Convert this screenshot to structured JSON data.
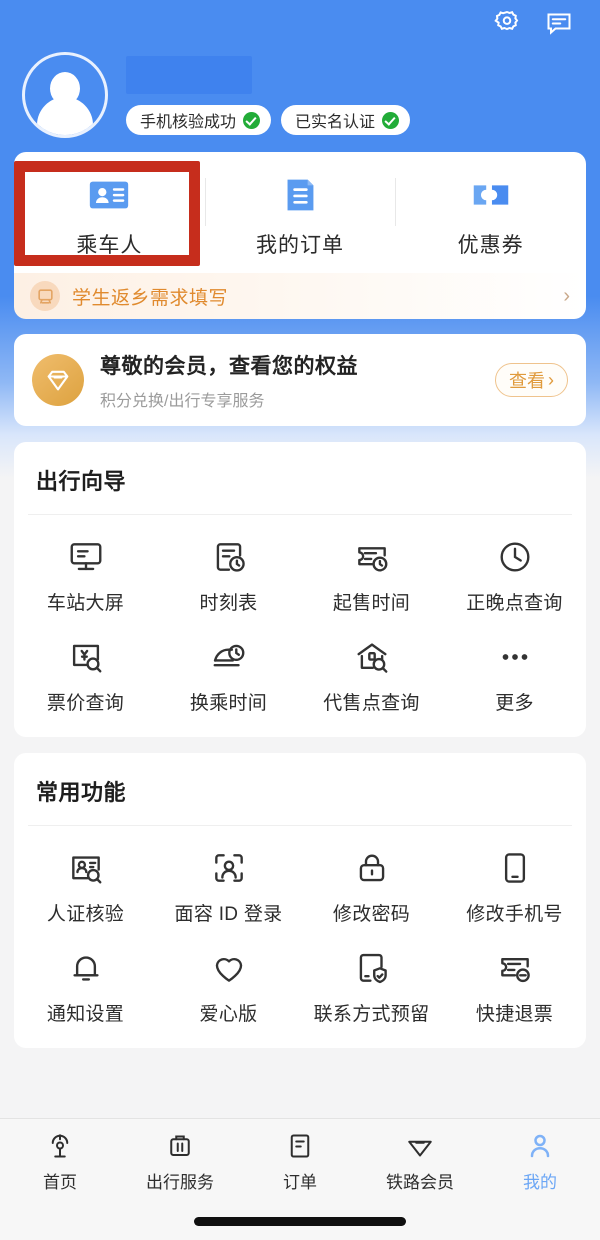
{
  "header": {
    "settings_icon": "gear-icon",
    "message_icon": "chat-bubble-icon",
    "avatar_icon": "user-avatar-icon",
    "name_redacted": "",
    "chips": [
      {
        "label": "手机核验成功",
        "icon": "check-circle-icon"
      },
      {
        "label": "已实名认证",
        "icon": "check-circle-icon"
      }
    ]
  },
  "quick_actions": {
    "items": [
      {
        "label": "乘车人",
        "icon": "id-card-icon",
        "highlighted": true
      },
      {
        "label": "我的订单",
        "icon": "order-document-icon",
        "highlighted": false
      },
      {
        "label": "优惠券",
        "icon": "coupon-ticket-icon",
        "highlighted": false
      }
    ],
    "highlight_color": "#c62d1c"
  },
  "student_banner": {
    "label": "学生返乡需求填写",
    "icon": "student-train-icon",
    "chevron": "›",
    "text_color": "#e08a2e"
  },
  "member_banner": {
    "icon": "diamond-icon",
    "title": "尊敬的会员，查看您的权益",
    "subtitle": "积分兑换/出行专享服务",
    "button_label": "查看",
    "button_chevron": "›",
    "accent_color": "#e09a3c"
  },
  "travel_guide": {
    "title": "出行向导",
    "items": [
      {
        "label": "车站大屏",
        "icon": "station-screen-icon"
      },
      {
        "label": "时刻表",
        "icon": "timetable-icon"
      },
      {
        "label": "起售时间",
        "icon": "ticket-clock-icon"
      },
      {
        "label": "正晚点查询",
        "icon": "clock-icon"
      },
      {
        "label": "票价查询",
        "icon": "fare-search-icon"
      },
      {
        "label": "换乘时间",
        "icon": "transfer-train-clock-icon"
      },
      {
        "label": "代售点查询",
        "icon": "agency-search-icon"
      },
      {
        "label": "更多",
        "icon": "more-dots-icon"
      }
    ]
  },
  "common_functions": {
    "title": "常用功能",
    "items": [
      {
        "label": "人证核验",
        "icon": "id-verify-icon"
      },
      {
        "label": "面容 ID 登录",
        "icon": "face-id-icon"
      },
      {
        "label": "修改密码",
        "icon": "lock-icon"
      },
      {
        "label": "修改手机号",
        "icon": "phone-icon"
      },
      {
        "label": "通知设置",
        "icon": "bell-icon"
      },
      {
        "label": "爱心版",
        "icon": "heart-icon"
      },
      {
        "label": "联系方式预留",
        "icon": "contact-shield-icon"
      },
      {
        "label": "快捷退票",
        "icon": "refund-ticket-icon"
      }
    ]
  },
  "tabbar": {
    "active_color": "#6ba6f5",
    "items": [
      {
        "label": "首页",
        "icon": "railway-home-icon",
        "active": false
      },
      {
        "label": "出行服务",
        "icon": "luggage-icon",
        "active": false
      },
      {
        "label": "订单",
        "icon": "order-icon",
        "active": false
      },
      {
        "label": "铁路会员",
        "icon": "member-diamond-icon",
        "active": false
      },
      {
        "label": "我的",
        "icon": "person-icon",
        "active": true
      }
    ]
  }
}
